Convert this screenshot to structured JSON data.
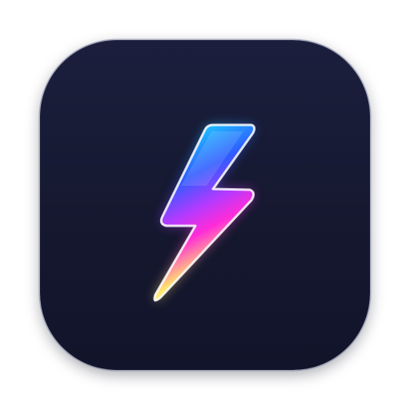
{
  "icon": {
    "name": "lightning-bolt-app-icon",
    "glyph": "lightning-bolt-icon",
    "colors": {
      "background_top": "#1b1f3d",
      "background_bottom": "#11142a",
      "bolt_cyan": "#19e3ff",
      "bolt_blue": "#2f5bff",
      "bolt_magenta": "#ff2bd9",
      "bolt_yellow": "#ffe86a",
      "bolt_white": "#ffffff"
    }
  }
}
